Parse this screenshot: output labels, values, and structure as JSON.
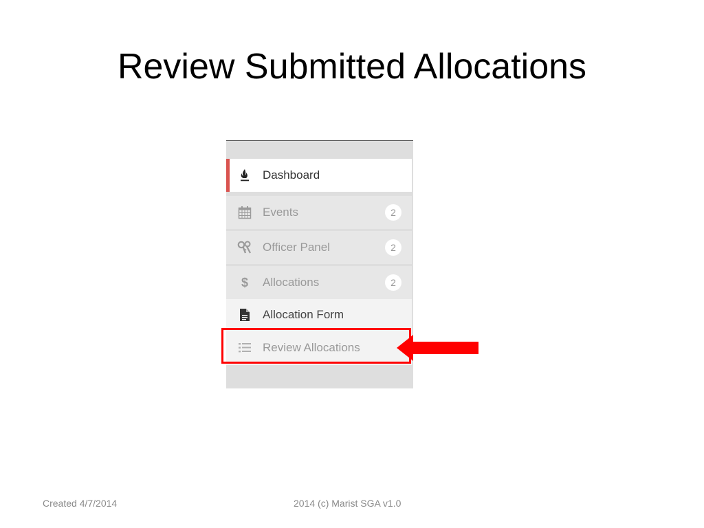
{
  "slide": {
    "title": "Review Submitted Allocations"
  },
  "sidebar": {
    "items": [
      {
        "label": "Dashboard",
        "icon": "fire-icon",
        "active": true
      },
      {
        "label": "Events",
        "icon": "calendar-icon",
        "badge": "2"
      },
      {
        "label": "Officer Panel",
        "icon": "keys-icon",
        "badge": "2"
      },
      {
        "label": "Allocations",
        "icon": "dollar-icon",
        "badge": "2"
      },
      {
        "label": "Allocation Form",
        "icon": "file-icon"
      },
      {
        "label": "Review Allocations",
        "icon": "list-icon"
      }
    ]
  },
  "footer": {
    "created": "Created 4/7/2014",
    "copyright": "2014 (c) Marist SGA v1.0"
  },
  "colors": {
    "active_accent": "#d9534f",
    "highlight": "#ff0000"
  }
}
